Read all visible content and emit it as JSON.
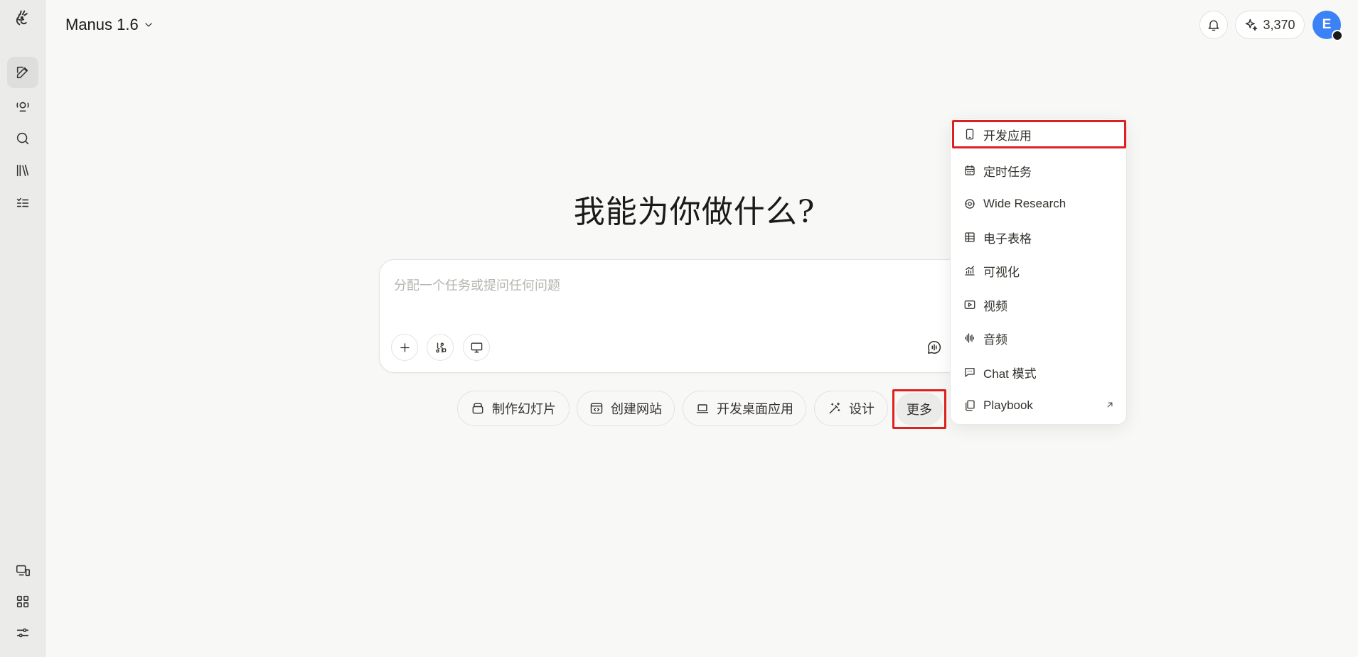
{
  "header": {
    "model_name": "Manus 1.6",
    "credits": "3,370",
    "avatar_initial": "E"
  },
  "sidebar": {
    "top_items": [
      {
        "icon": "new-task-icon",
        "active": true
      },
      {
        "icon": "agents-icon"
      },
      {
        "icon": "search-icon"
      },
      {
        "icon": "library-icon"
      },
      {
        "icon": "tasks-list-icon"
      }
    ],
    "bottom_items": [
      {
        "icon": "devices-icon"
      },
      {
        "icon": "apps-grid-icon"
      },
      {
        "icon": "settings-sliders-icon"
      }
    ]
  },
  "main": {
    "title": "我能为你做什么?",
    "composer": {
      "placeholder": "分配一个任务或提问任何问题",
      "value": ""
    },
    "quick_actions": [
      {
        "label": "制作幻灯片",
        "icon": "slides-icon"
      },
      {
        "label": "创建网站",
        "icon": "website-icon"
      },
      {
        "label": "开发桌面应用",
        "icon": "laptop-icon"
      },
      {
        "label": "设计",
        "icon": "design-wand-icon"
      }
    ],
    "more_label": "更多"
  },
  "more_menu": {
    "items": [
      {
        "label": "开发应用",
        "icon": "mobile-icon"
      },
      {
        "label": "定时任务",
        "icon": "calendar-icon"
      },
      {
        "label": "Wide Research",
        "icon": "wide-research-icon"
      },
      {
        "label": "电子表格",
        "icon": "spreadsheet-icon"
      },
      {
        "label": "可视化",
        "icon": "chart-icon"
      },
      {
        "label": "视频",
        "icon": "video-icon"
      },
      {
        "label": "音频",
        "icon": "audio-wave-icon"
      },
      {
        "label": "Chat 模式",
        "icon": "chat-icon"
      },
      {
        "label": "Playbook",
        "icon": "playbook-icon"
      }
    ]
  },
  "colors": {
    "accent": "#3b82f6",
    "highlight_border": "#e02020",
    "background": "#f8f8f7",
    "sidebar": "#ebebea"
  }
}
